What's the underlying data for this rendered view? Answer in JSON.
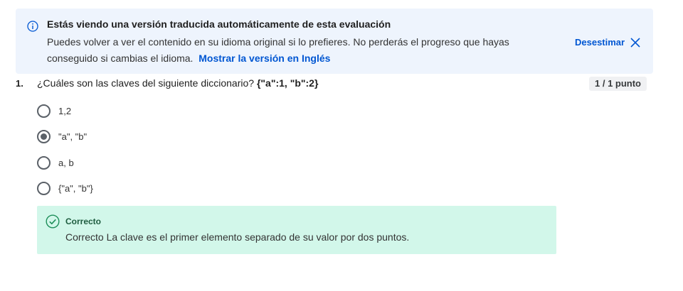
{
  "banner": {
    "title": "Estás viendo una versión traducida automáticamente de esta evaluación",
    "body": "Puedes volver a ver el contenido en su idioma original si lo prefieres. No perderás el progreso que hayas conseguido si cambias el idioma.",
    "link_label": "Mostrar la versión en Inglés",
    "dismiss_label": "Desestimar",
    "info_icon": "info-icon",
    "close_icon": "close-icon"
  },
  "question": {
    "number": "1.",
    "text": "¿Cuáles son las claves del siguiente diccionario?",
    "code": "{\"a\":1, \"b\":2}",
    "score": "1 / 1 punto",
    "options": [
      {
        "label": "1,2",
        "selected": false
      },
      {
        "label": "\"a\", \"b\"",
        "selected": true
      },
      {
        "label": "a, b",
        "selected": false
      },
      {
        "label": "{\"a\", \"b\"}",
        "selected": false
      }
    ]
  },
  "feedback": {
    "title": "Correcto",
    "text": "Correcto La clave es el primer elemento separado de su valor por dos puntos.",
    "icon": "check-circle-icon"
  },
  "colors": {
    "banner_bg": "#eef4fd",
    "link": "#0056d2",
    "feedback_bg": "#d2f7ea",
    "feedback_title": "#1e5c3f"
  }
}
